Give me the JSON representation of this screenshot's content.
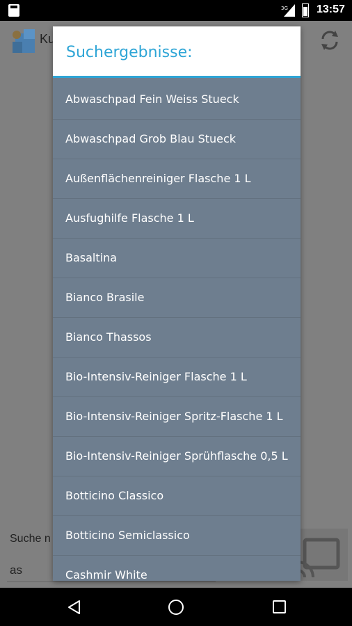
{
  "status_bar": {
    "time": "13:57",
    "signal_label": "3G"
  },
  "action_bar": {
    "title": "Ku"
  },
  "background": {
    "search_label": "Suche n",
    "search_value": "as"
  },
  "dialog": {
    "title": "Suchergebnisse:",
    "items": [
      "Abwaschpad Fein Weiss Stueck",
      "Abwaschpad Grob Blau Stueck",
      "Außenflächenreiniger Flasche 1 L",
      "Ausfughilfe Flasche 1 L",
      "Basaltina",
      "Bianco Brasile",
      "Bianco Thassos",
      "Bio-Intensiv-Reiniger Flasche 1 L",
      "Bio-Intensiv-Reiniger Spritz-Flasche 1 L",
      "Bio-Intensiv-Reiniger Sprühflasche 0,5 L",
      "Botticino Classico",
      "Botticino Semiclassico",
      "Cashmir White"
    ]
  },
  "colors": {
    "accent": "#2ea5d6",
    "dialog_bg": "#6e7e8f"
  }
}
